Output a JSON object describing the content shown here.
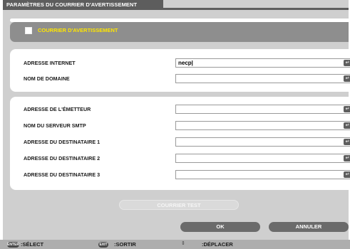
{
  "window": {
    "title": "PARAMÈTRES DU COURRIER D'AVERTISSEMENT"
  },
  "alert": {
    "label": "COURRIER D'AVERTISSEMENT",
    "checked": false,
    "color": "#ffe600"
  },
  "section1": {
    "rows": [
      {
        "label": "ADRESSE INTERNET",
        "value": "necp|"
      },
      {
        "label": "NOM DE DOMAINE",
        "value": ""
      }
    ]
  },
  "section2": {
    "rows": [
      {
        "label": "ADRESSE DE L'ÉMETTEUR",
        "value": ""
      },
      {
        "label": "NOM DU SERVEUR SMTP",
        "value": ""
      },
      {
        "label": "ADRESSE DU DESTINATAIRE 1",
        "value": ""
      },
      {
        "label": "ADRESSE DU DESTINATAIRE 2",
        "value": ""
      },
      {
        "label": "ADRESSE DU DESTINATAIRE 3",
        "value": ""
      }
    ]
  },
  "buttons": {
    "test": "COURRIER TEST",
    "ok": "OK",
    "cancel": "ANNULER"
  },
  "footer": {
    "enter_key": "ENTER",
    "select": ":SÉLECT",
    "exit_key": "EXIT",
    "exit": ":SORTIR",
    "arrows": "⇕",
    "move": ":DÉPLACER"
  },
  "icons": {
    "enter": "↵"
  }
}
